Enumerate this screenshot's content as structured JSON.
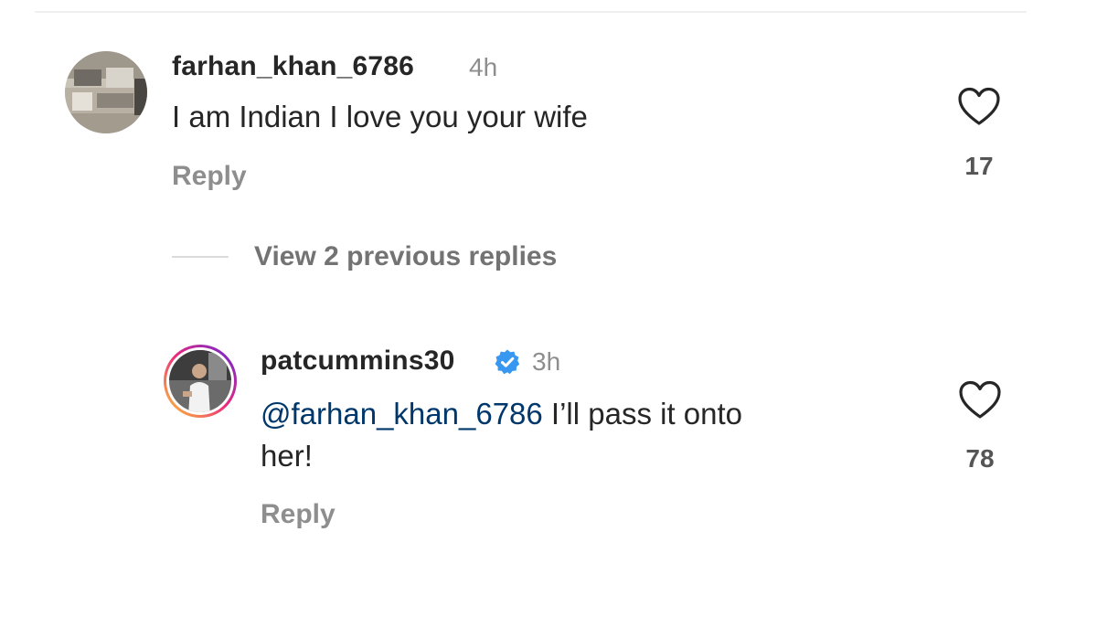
{
  "comments": [
    {
      "username": "farhan_khan_6786",
      "time": "4h",
      "text": "I am Indian I love you your wife",
      "reply_label": "Reply",
      "like_count": "17",
      "avatar_icon": "room-photo-avatar"
    },
    {
      "username": "patcummins30",
      "verified": true,
      "time": "3h",
      "mention": "@farhan_khan_6786",
      "text_line1": " I’ll pass it onto",
      "text_line2": "her!",
      "reply_label": "Reply",
      "like_count": "78",
      "avatar_icon": "person-photo-avatar-story-ring"
    }
  ],
  "view_replies_label": "View 2 previous replies",
  "colors": {
    "text": "#262626",
    "muted": "#8e8e8e",
    "mention": "#00376b",
    "verified_blue": "#3897f0",
    "story_ring_start": "#f9ce34",
    "story_ring_end": "#c13584"
  },
  "icons": {
    "like": "heart-outline-icon",
    "verified": "verified-badge-icon"
  }
}
